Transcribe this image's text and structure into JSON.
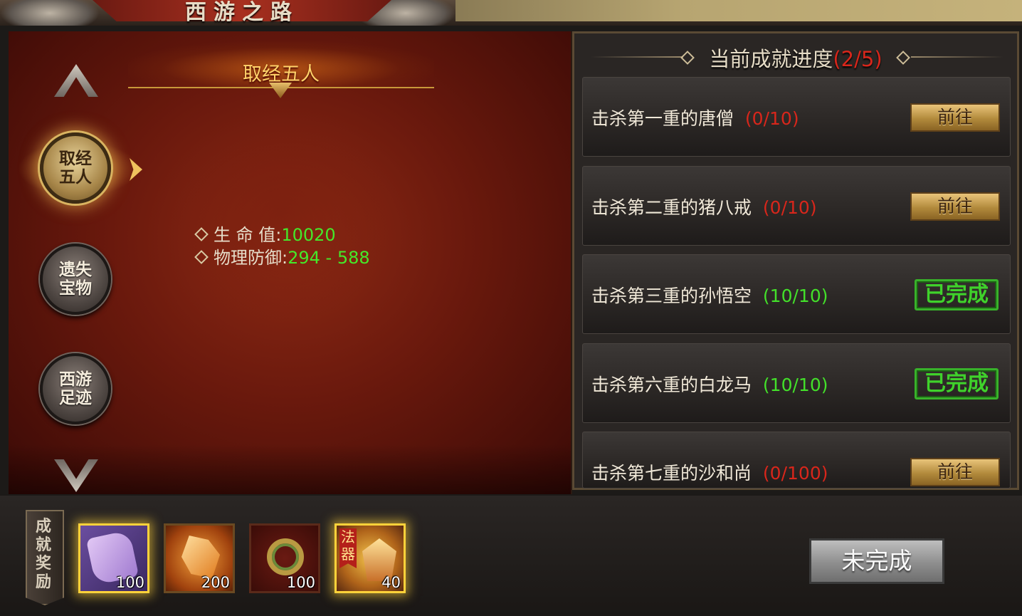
{
  "window": {
    "title": "西游之路"
  },
  "left": {
    "stage_title": "取经五人",
    "categories": [
      {
        "label": "取经五人",
        "active": true
      },
      {
        "label": "遗失宝物",
        "active": false
      },
      {
        "label": "西游足迹",
        "active": false
      }
    ],
    "stats": [
      {
        "label": "生 命 值:",
        "value": "10020"
      },
      {
        "label": "物理防御:",
        "value": "294 - 588"
      }
    ]
  },
  "progress": {
    "title": "当前成就进度",
    "ratio": "(2/5)",
    "tasks": [
      {
        "text": "击杀第一重的唐僧",
        "count": "(0/10)",
        "done": false,
        "action": "前往"
      },
      {
        "text": "击杀第二重的猪八戒",
        "count": "(0/10)",
        "done": false,
        "action": "前往"
      },
      {
        "text": "击杀第三重的孙悟空",
        "count": "(10/10)",
        "done": true,
        "action": "已完成"
      },
      {
        "text": "击杀第六重的白龙马",
        "count": "(10/10)",
        "done": true,
        "action": "已完成"
      },
      {
        "text": "击杀第七重的沙和尚",
        "count": "(0/100)",
        "done": false,
        "action": "前往"
      }
    ]
  },
  "rewards": {
    "label": "成就奖励",
    "items": [
      {
        "icon": "scroll-icon",
        "qty": "100"
      },
      {
        "icon": "ore-icon",
        "qty": "200"
      },
      {
        "icon": "coin-string-icon",
        "qty": "100"
      },
      {
        "icon": "magic-weapon-icon",
        "qty": "40",
        "tag": "法器"
      }
    ]
  },
  "status_button": {
    "label": "未完成"
  },
  "colors": {
    "red": "#d8261b",
    "green": "#43e02a",
    "gold": "#ffd36a"
  }
}
